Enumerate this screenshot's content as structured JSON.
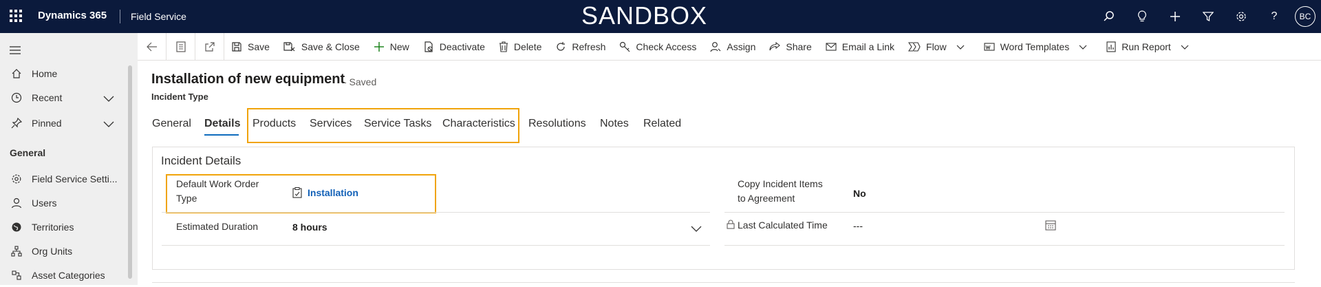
{
  "topbar": {
    "app_name": "Dynamics 365",
    "area_name": "Field Service",
    "environment_banner": "SANDBOX",
    "icons": [
      "search-icon",
      "lightbulb-icon",
      "plus-icon",
      "filter-icon",
      "gear-icon",
      "help-icon"
    ],
    "avatar_initials": "BC"
  },
  "nav": {
    "items": [
      {
        "label": "Home",
        "icon": "home-icon"
      },
      {
        "label": "Recent",
        "icon": "clock-icon"
      },
      {
        "label": "Pinned",
        "icon": "pin-icon"
      }
    ],
    "group_label": "General",
    "group_items": [
      {
        "label": "Field Service Setti...",
        "icon": "gear-icon"
      },
      {
        "label": "Users",
        "icon": "person-icon"
      },
      {
        "label": "Territories",
        "icon": "globe-icon"
      },
      {
        "label": "Org Units",
        "icon": "org-chart-icon"
      },
      {
        "label": "Asset Categories",
        "icon": "asset-icon"
      }
    ]
  },
  "commands": {
    "save": "Save",
    "save_close": "Save & Close",
    "new": "New",
    "deactivate": "Deactivate",
    "delete": "Delete",
    "refresh": "Refresh",
    "check_access": "Check Access",
    "assign": "Assign",
    "share": "Share",
    "email_link": "Email a Link",
    "flow": "Flow",
    "word_templates": "Word Templates",
    "run_report": "Run Report"
  },
  "record": {
    "title": "Installation of new equipment",
    "status": "- Saved",
    "entity": "Incident Type"
  },
  "tabs": [
    "General",
    "Details",
    "Products",
    "Services",
    "Service Tasks",
    "Characteristics",
    "Resolutions",
    "Notes",
    "Related"
  ],
  "active_tab": "Details",
  "section": {
    "title": "Incident Details",
    "default_wo_type_label_1": "Default Work Order",
    "default_wo_type_label_2": "Type",
    "default_wo_type_value": "Installation",
    "estimated_duration_label": "Estimated Duration",
    "estimated_duration_value": "8 hours",
    "copy_items_label_1": "Copy Incident Items",
    "copy_items_label_2": "to Agreement",
    "copy_items_value": "No",
    "last_calc_label": "Last Calculated Time",
    "last_calc_value": "---"
  },
  "colors": {
    "topbar_bg": "#0b1a3c",
    "highlight": "#f0a30a",
    "link": "#1160b7",
    "active_tab_underline": "#0f6cbd"
  }
}
